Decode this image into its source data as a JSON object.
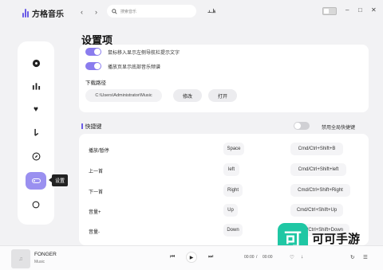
{
  "app": {
    "name": "方格音乐",
    "brand_color": "#6b5ce7",
    "accent_color": "#9a90f0"
  },
  "titlebar": {
    "back_icon": "chevron-left-icon",
    "forward_icon": "chevron-right-icon",
    "search_placeholder": "搜索音乐",
    "wave_icon": "waveform-icon",
    "window_controls": [
      "minimize-icon",
      "maximize-icon",
      "close-icon"
    ]
  },
  "sidebar": {
    "items": [
      {
        "id": "music",
        "icon": "disc-icon"
      },
      {
        "id": "charts",
        "icon": "bar-chart-icon"
      },
      {
        "id": "favorites",
        "icon": "heart-icon"
      },
      {
        "id": "downloads",
        "icon": "download-icon"
      },
      {
        "id": "explore",
        "icon": "compass-icon"
      },
      {
        "id": "settings",
        "icon": "toggle-icon",
        "active": true,
        "tooltip": "设置"
      },
      {
        "id": "theme",
        "icon": "moon-icon"
      }
    ]
  },
  "page": {
    "title": "设置项"
  },
  "general": {
    "options": [
      {
        "label": "鼠标移入显示左侧导航栏提示文字",
        "enabled": true
      },
      {
        "label": "播放页显示底部音乐频谱",
        "enabled": true
      }
    ],
    "download_path_label": "下载路径",
    "download_path_value": "C:\\Users\\Administrator\\Music",
    "modify_button": "修改",
    "open_button": "打开"
  },
  "shortcuts": {
    "title": "快捷键",
    "global_label": "禁用全局快捷键",
    "global_enabled": false,
    "rows": [
      {
        "name": "播放/暂停",
        "local": "Space",
        "global": "Cmd/Ctrl+Shift+B"
      },
      {
        "name": "上一首",
        "local": "left",
        "global": "Cmd/Ctrl+Shift+left"
      },
      {
        "name": "下一首",
        "local": "Right",
        "global": "Cmd/Ctrl+Shift+Right"
      },
      {
        "name": "音量+",
        "local": "Up",
        "global": "Cmd/Ctrl+Shift+Up"
      },
      {
        "name": "音量-",
        "local": "Down",
        "global": "Cmd/Ctrl+Shift+Down"
      }
    ]
  },
  "player": {
    "song": "FONGER",
    "artist": "Music",
    "current_time": "00:00",
    "separator": "/",
    "total_time": "00:00"
  },
  "watermark": {
    "icon_char": "可",
    "text": "可可手游",
    "color": "#1fc7a4"
  }
}
